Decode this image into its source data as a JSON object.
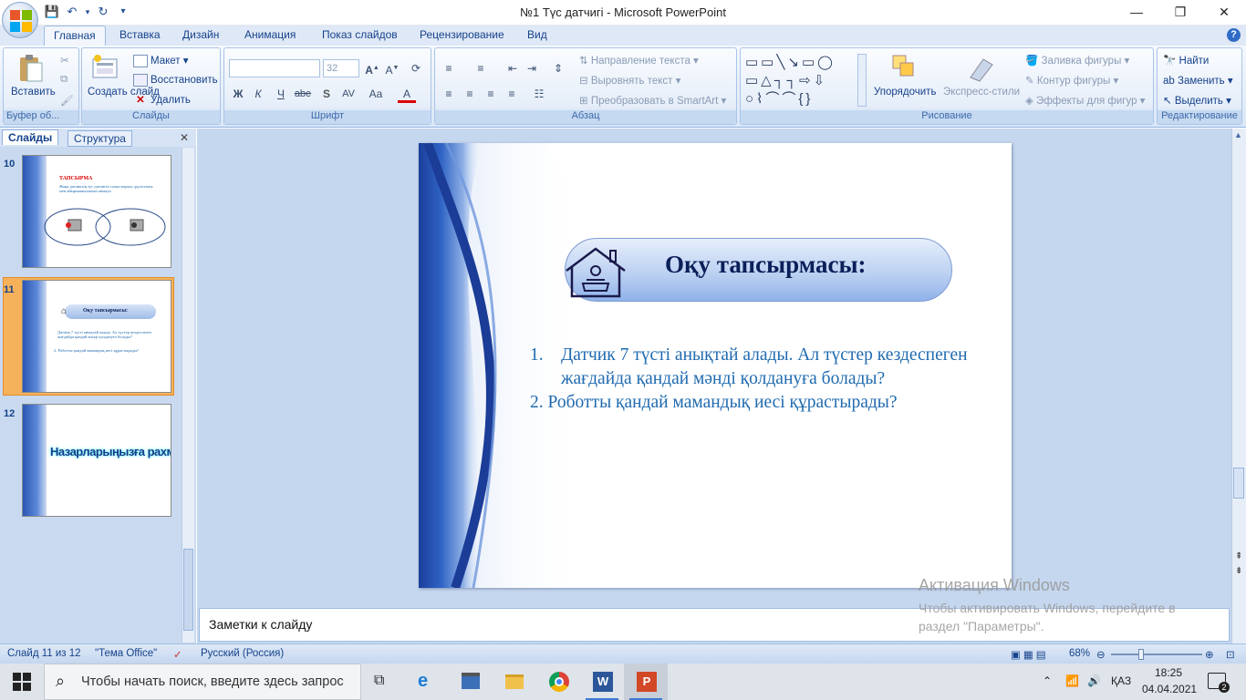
{
  "window": {
    "title": "№1 Түс датчигі - Microsoft PowerPoint"
  },
  "tabs": [
    "Главная",
    "Вставка",
    "Дизайн",
    "Анимация",
    "Показ слайдов",
    "Рецензирование",
    "Вид"
  ],
  "ribbon": {
    "clipboard": {
      "paste": "Вставить",
      "label": "Буфер об..."
    },
    "slides": {
      "new_slide": "Создать слайд",
      "layout": "Макет",
      "reset": "Восстановить",
      "delete": "Удалить",
      "label": "Слайды"
    },
    "font": {
      "size": "32",
      "label": "Шрифт",
      "bold": "Ж",
      "italic": "К",
      "underline": "Ч",
      "strike": "abe",
      "spacing": "AV",
      "case": "Aa"
    },
    "paragraph": {
      "text_dir": "Направление текста",
      "align_text": "Выровнять текст",
      "smartart": "Преобразовать в SmartArt",
      "label": "Абзац"
    },
    "drawing": {
      "arrange": "Упорядочить",
      "quick_styles": "Экспресс-стили",
      "fill": "Заливка фигуры",
      "outline": "Контур фигуры",
      "effects": "Эффекты для фигур",
      "label": "Рисование"
    },
    "editing": {
      "find": "Найти",
      "replace": "Заменить",
      "select": "Выделить",
      "label": "Редактирование"
    }
  },
  "panel": {
    "tab_slides": "Слайды",
    "tab_outline": "Структура"
  },
  "thumbnails": [
    {
      "num": "10",
      "title": "ТАПСЫРМА",
      "body": "Жаңа датчиктің тус датчигін салыстырып, ұқсастығы мен айырмашылығын анықта"
    },
    {
      "num": "11",
      "title": "Оқу тапсырмасы:",
      "line1": "Датчик 7 түсті анықтай алады. Ал түстер кездеспеген жағдайда қандай мәнді қолдануға болады?",
      "line2": "2. Роботты қандай мамандық иесі құрастырады?"
    },
    {
      "num": "12",
      "title": "Назарларыңызға рахмет!"
    }
  ],
  "slide": {
    "title": "Оқу тапсырмасы:",
    "items": [
      {
        "num": "1.",
        "text": "Датчик 7 түсті анықтай алады. Ал түстер кездеспеген жағдайда қандай мәнді қолдануға болады?"
      },
      {
        "num": "",
        "text": "2. Роботты қандай мамандық иесі құрастырады?"
      }
    ]
  },
  "notes": {
    "placeholder": "Заметки к слайду"
  },
  "status": {
    "slide": "Слайд 11 из 12",
    "theme": "\"Тема Office\"",
    "language": "Русский (Россия)",
    "zoom": "68%"
  },
  "activation": {
    "title": "Активация Windows",
    "text": "Чтобы активировать Windows, перейдите в раздел \"Параметры\"."
  },
  "taskbar": {
    "search": "Чтобы начать поиск, введите здесь запрос",
    "lang": "ҚАЗ",
    "time": "18:25",
    "date": "04.04.2021",
    "notif": "2"
  },
  "colors": {
    "slide_title": "#0b1f59",
    "slide_text": "#1f6ab0",
    "accent": "#2a56b4"
  }
}
